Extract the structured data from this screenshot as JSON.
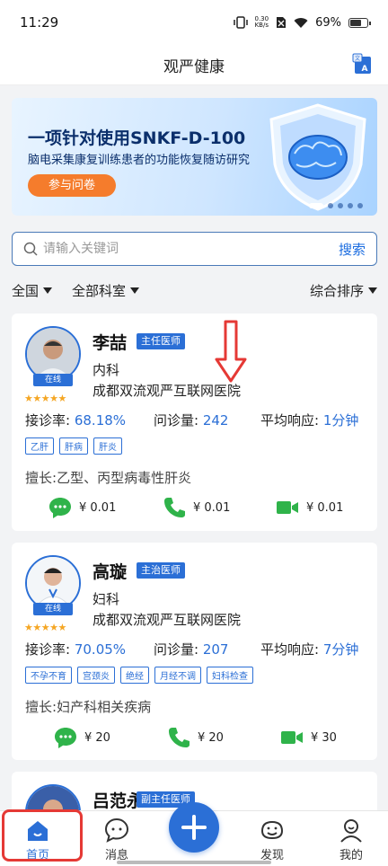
{
  "status_bar": {
    "time": "11:29",
    "net_speed_top": "0.30",
    "net_speed_bottom": "KB/s",
    "battery_label": "69%",
    "battery_level": 0.69
  },
  "nav": {
    "title": "观严健康"
  },
  "banner": {
    "title": "一项针对使用SNKF-D-100",
    "subtitle": "脑电采集康复训练患者的功能恢复随访研究",
    "button": "参与问卷"
  },
  "search": {
    "placeholder": "请输入关键词",
    "button": "搜索"
  },
  "filters": {
    "region": "全国",
    "department": "全部科室",
    "sort": "综合排序"
  },
  "labels": {
    "accept_rate": "接诊率:",
    "consult_count": "问诊量:",
    "avg_response": "平均响应:",
    "skill_prefix": "擅长:",
    "online": "在线",
    "stars": "★★★★★"
  },
  "doctors": [
    {
      "name": "李喆",
      "title": "主任医师",
      "department": "内科",
      "hospital": "成都双流观严互联网医院",
      "accept_rate": "68.18%",
      "consult_count": "242",
      "avg_response": "1分钟",
      "tags": [
        "乙肝",
        "肝病",
        "肝炎"
      ],
      "skill": "乙型、丙型病毒性肝炎",
      "prices": {
        "text": "¥ 0.01",
        "phone": "¥ 0.01",
        "video": "¥ 0.01"
      }
    },
    {
      "name": "高璇",
      "title": "主治医师",
      "department": "妇科",
      "hospital": "成都双流观严互联网医院",
      "accept_rate": "70.05%",
      "consult_count": "207",
      "avg_response": "7分钟",
      "tags": [
        "不孕不育",
        "宫颈炎",
        "绝经",
        "月经不调",
        "妇科检查"
      ],
      "skill": "妇产科相关疾病",
      "prices": {
        "text": "¥ 20",
        "phone": "¥ 20",
        "video": "¥ 30"
      }
    },
    {
      "name": "吕范永",
      "title": "副主任医师"
    }
  ],
  "tabbar": {
    "home": "首页",
    "messages": "消息",
    "discover": "发现",
    "me": "我的"
  },
  "colors": {
    "accent": "#2b6fd6",
    "price_icon": "#2fb34a",
    "highlight": "#e53935",
    "star": "#f5a623"
  }
}
